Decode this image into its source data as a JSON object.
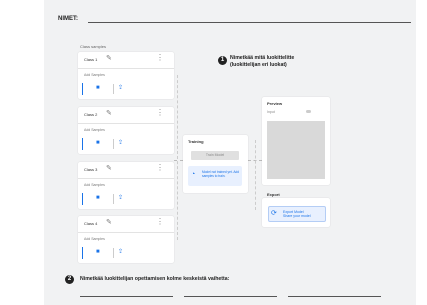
{
  "worksheet": {
    "name_label": "NIMET:",
    "question1": {
      "number": "1",
      "text_line1": "Nimetkää mitä luokittelitte",
      "text_line2": "(luokittelijan eri luokat)"
    },
    "question2": {
      "number": "2",
      "text": "Nimetkää luokittelijan opettamisen kolme keskeistä  vaihetta:"
    }
  },
  "classifier": {
    "classes_label": "Class samples",
    "classes": [
      {
        "name": "Class 1",
        "samples": "Add Samples"
      },
      {
        "name": "Class 2",
        "samples": "Add Samples"
      },
      {
        "name": "Class 3",
        "samples": "Add Samples"
      },
      {
        "name": "Class 4",
        "samples": "Add Samples"
      }
    ],
    "webcam_icon": "video-icon",
    "upload_icon": "upload-icon",
    "training": {
      "title": "Training",
      "button": "Train Model",
      "info": "Model not trained yet. Add samples to train."
    },
    "preview": {
      "title": "Preview",
      "subtitle": "Input",
      "accent": "#1a73e8"
    },
    "export": {
      "title": "Export",
      "button": "Export Model",
      "button_sub": "Share your model"
    }
  }
}
